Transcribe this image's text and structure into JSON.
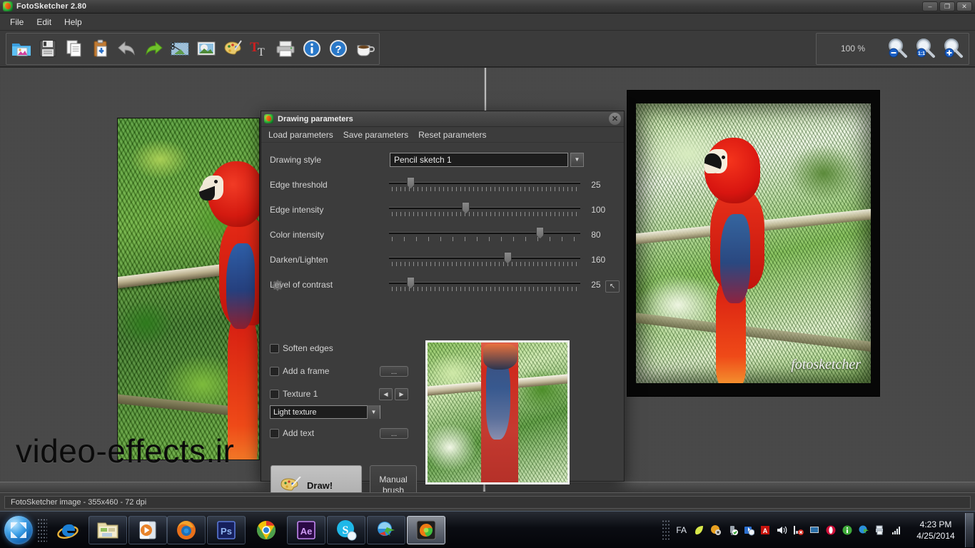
{
  "window": {
    "title": "FotoSketcher 2.80",
    "icon": "fotosketcher-logo-icon",
    "buttons": {
      "minimize": "–",
      "restore": "❐",
      "close": "✕"
    }
  },
  "menubar": {
    "items": [
      "File",
      "Edit",
      "Help"
    ]
  },
  "toolbar": {
    "tools": [
      {
        "name": "open-image",
        "icon": "open-folder-image-icon"
      },
      {
        "name": "save-image",
        "icon": "floppy-save-icon"
      },
      {
        "name": "copy",
        "icon": "copy-pages-icon"
      },
      {
        "name": "paste",
        "icon": "clipboard-paste-icon"
      },
      {
        "name": "undo",
        "icon": "undo-arrow-icon"
      },
      {
        "name": "redo",
        "icon": "redo-arrow-icon"
      },
      {
        "name": "crop-image",
        "icon": "scissors-crop-icon"
      },
      {
        "name": "resize-image",
        "icon": "picture-icon"
      },
      {
        "name": "drawing-parameters",
        "icon": "palette-icon"
      },
      {
        "name": "add-text",
        "icon": "text-tool-icon"
      },
      {
        "name": "print",
        "icon": "printer-icon"
      },
      {
        "name": "about",
        "icon": "info-icon"
      },
      {
        "name": "help",
        "icon": "question-help-icon"
      },
      {
        "name": "donate",
        "icon": "coffee-cup-icon"
      }
    ],
    "zoom_percent": "100 %",
    "zoom_buttons": [
      {
        "name": "zoom-out",
        "icon": "magnifier-minus-icon"
      },
      {
        "name": "zoom-actual",
        "icon": "magnifier-one-to-one-icon"
      },
      {
        "name": "zoom-in",
        "icon": "magnifier-plus-icon"
      }
    ]
  },
  "canvas": {
    "watermark": "video-effects.ir",
    "source_alt": "scarlet-macaw-photo",
    "result_alt": "scarlet-macaw-pencil-sketch",
    "result_signature": "fotosketcher"
  },
  "dialog": {
    "title": "Drawing parameters",
    "icon": "fotosketcher-logo-icon",
    "close_label": "✕",
    "menu": [
      "Load parameters",
      "Save parameters",
      "Reset parameters"
    ],
    "style_label": "Drawing style",
    "style_value": "Pencil sketch 1",
    "sliders": [
      {
        "label": "Edge threshold",
        "value": "25",
        "pos_pct": 11,
        "tick_style": "fine"
      },
      {
        "label": "Edge intensity",
        "value": "100",
        "pos_pct": 40,
        "tick_style": "fine"
      },
      {
        "label": "Color intensity",
        "value": "80",
        "pos_pct": 79,
        "tick_style": "wide"
      },
      {
        "label": "Darken/Lighten",
        "value": "160",
        "pos_pct": 62,
        "tick_style": "fine"
      },
      {
        "label": "Level of contrast",
        "value": "25",
        "pos_pct": 11,
        "tick_style": "fine"
      }
    ],
    "checkboxes": [
      {
        "label": "Soften edges",
        "checked": false,
        "extra": "none"
      },
      {
        "label": "Add a frame",
        "checked": false,
        "extra": "dots"
      },
      {
        "label": "Texture 1",
        "checked": false,
        "extra": "arrows"
      },
      {
        "label": "Add text",
        "checked": false,
        "extra": "dots"
      }
    ],
    "dots_button_label": "...",
    "arrow_prev": "◀",
    "arrow_next": "▶",
    "texture_value": "Light texture",
    "draw_button": "Draw!",
    "draw_icon": "palette-brush-icon",
    "manual_brush_button": "Manual\nbrush",
    "manual_brush_line1": "Manual",
    "manual_brush_line2": "brush",
    "settings_icon": "gear-icon",
    "resize_grip_icon": "resize-corner-icon",
    "preview_alt": "sketch-preview-thumbnail"
  },
  "statusbar": {
    "text": "FotoSketcher image - 355x460 - 72 dpi"
  },
  "taskbar": {
    "start_icon": "windows-start-orb-icon",
    "quick_launch": [
      {
        "name": "internet-explorer",
        "icon": "internet-explorer-icon"
      },
      {
        "name": "windows-explorer",
        "icon": "folder-explorer-icon"
      },
      {
        "name": "windows-media-player",
        "icon": "media-player-icon"
      }
    ],
    "tasks": [
      {
        "name": "firefox",
        "icon": "firefox-icon",
        "active": false
      },
      {
        "name": "photoshop",
        "icon": "photoshop-ps-icon",
        "active": false,
        "label": "Ps"
      },
      {
        "name": "chrome",
        "icon": "chrome-icon",
        "active": false
      },
      {
        "name": "after-effects",
        "icon": "after-effects-ae-icon",
        "active": false,
        "label": "Ae"
      },
      {
        "name": "skype",
        "icon": "skype-icon",
        "active": false
      },
      {
        "name": "internet-download-manager",
        "icon": "idm-icon",
        "active": false
      },
      {
        "name": "fotosketcher",
        "icon": "fotosketcher-logo-icon",
        "active": true
      }
    ],
    "tray": {
      "language": "FA",
      "icons": [
        "leaf-icon",
        "avg-shield-icon",
        "usb-safely-remove-icon",
        "bluetooth-icon",
        "autodesk-icon",
        "volume-speaker-icon",
        "network-error-icon",
        "display-icon",
        "opera-icon",
        "info-icon",
        "idm-tray-icon",
        "printer-tray-icon",
        "signal-bars-icon"
      ],
      "time": "4:23 PM",
      "date": "4/25/2014"
    },
    "show_desktop": "show-desktop-button"
  },
  "colors": {
    "window_bg": "#3c3c3c",
    "toolbar_bg": "#3b3b3b",
    "canvas_bg": "#4b4b4b",
    "text": "#d2d2d2",
    "accent_green": "#3fbf3f",
    "accent_orange": "#ff8a18"
  }
}
